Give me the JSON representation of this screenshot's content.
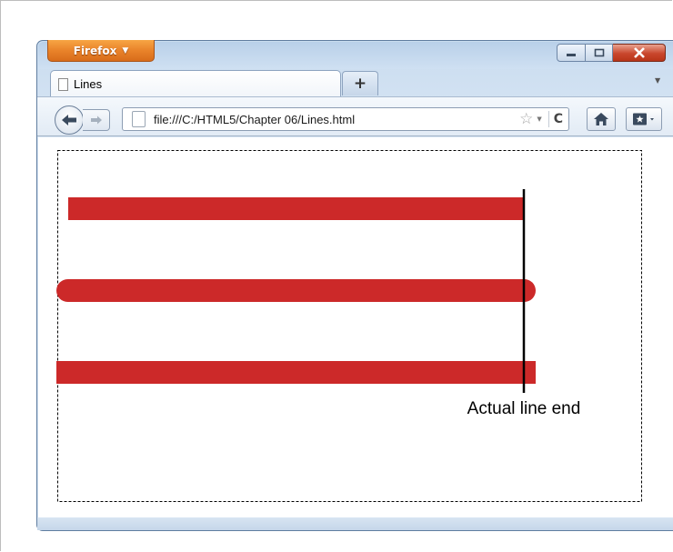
{
  "window": {
    "app_button_label": "Firefox",
    "controls": [
      "minimize",
      "maximize",
      "close"
    ]
  },
  "tabs": [
    {
      "title": "Lines"
    }
  ],
  "new_tab_label": "+",
  "navigation": {
    "url": "file:///C:/HTML5/Chapter 06/Lines.html"
  },
  "icons": {
    "back": "back-arrow-icon",
    "forward": "forward-arrow-icon",
    "page": "page-icon",
    "bookmark_star": "star-icon",
    "reload": "reload-icon",
    "home": "home-icon",
    "bookmarks": "bookmarks-icon"
  },
  "canvas": {
    "line_color": "#cc2929",
    "line_caps": [
      "butt",
      "round",
      "square"
    ],
    "annotation": "Actual line end"
  }
}
